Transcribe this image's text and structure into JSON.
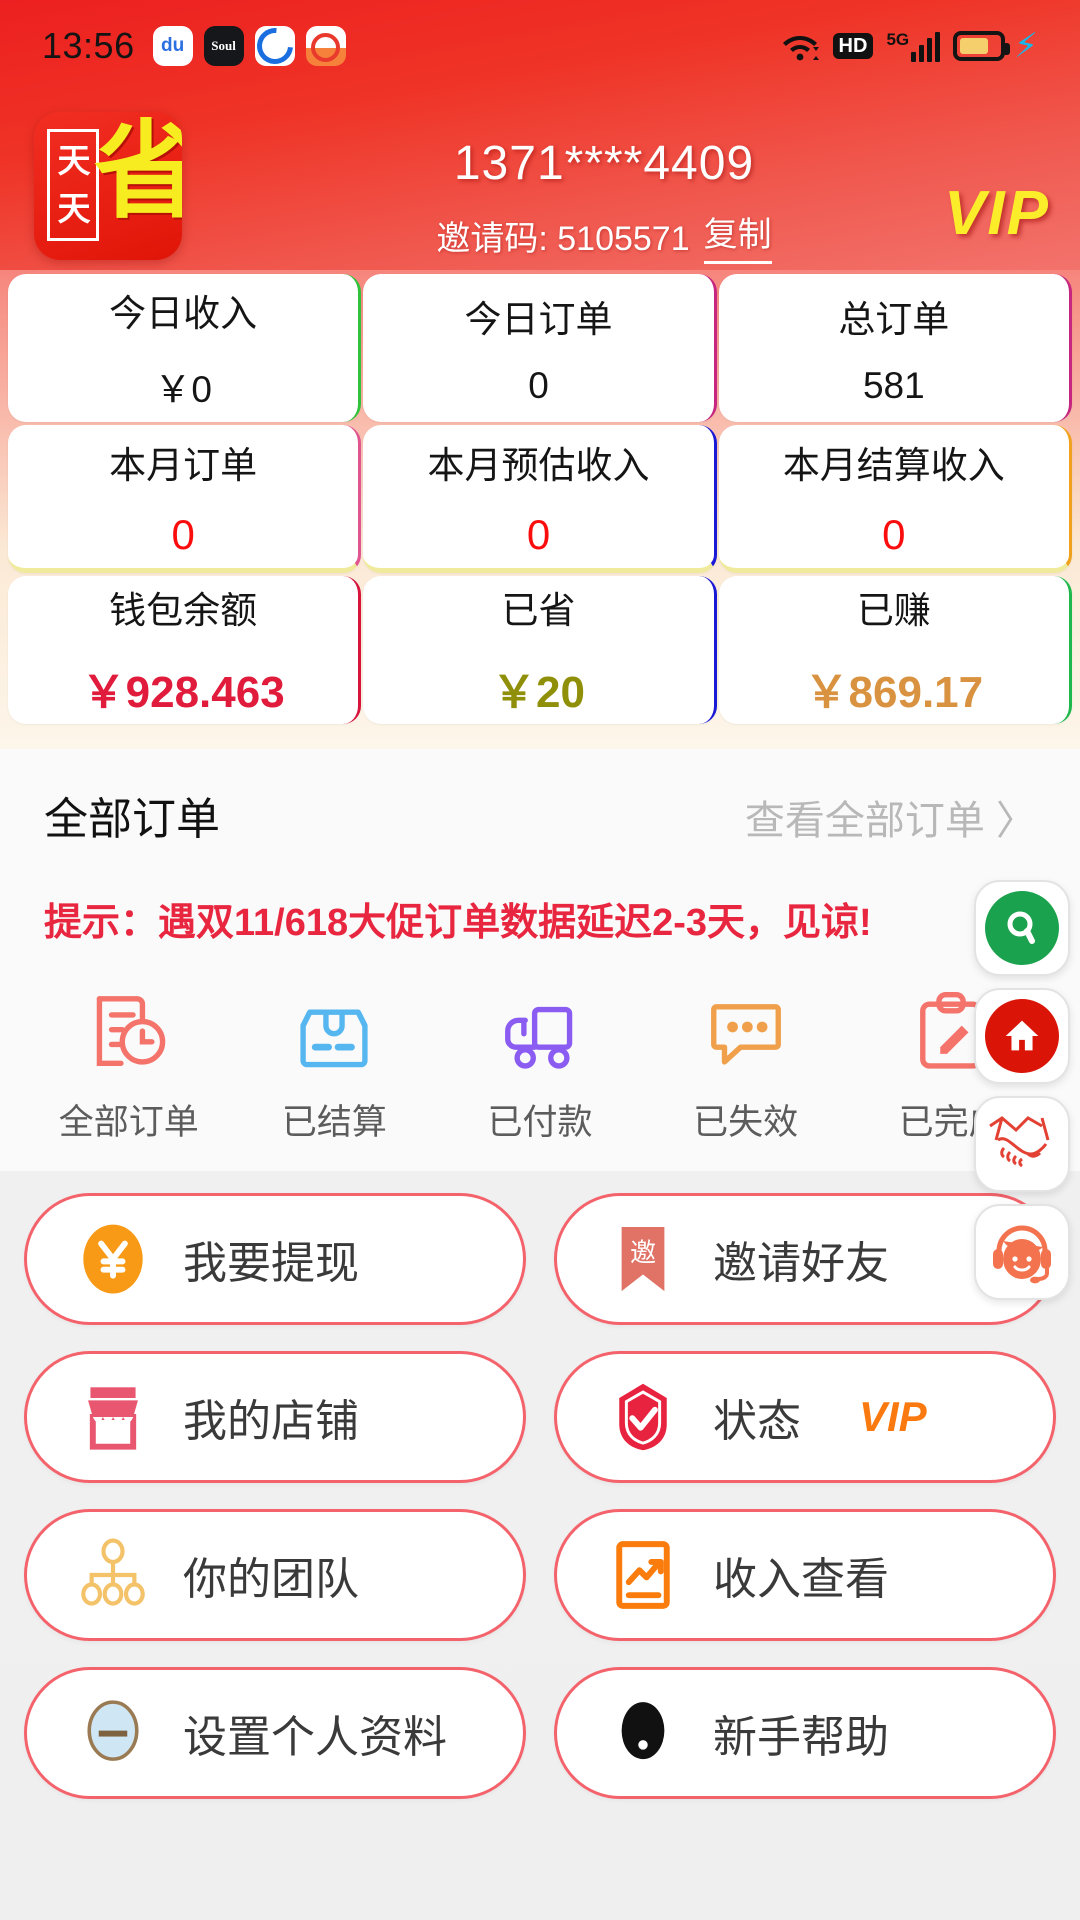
{
  "statusbar": {
    "time": "13:56",
    "apps": [
      "baidu-icon",
      "soul-icon",
      "qq-browser-icon",
      "calendar-icon"
    ],
    "app_labels": [
      "du",
      "Soul",
      "",
      ""
    ],
    "wifi": "wifi-icon",
    "hd": "HD",
    "network": "5G",
    "battery": "battery-icon",
    "charging": "charging-bolt-icon"
  },
  "header": {
    "logo_text_top": "天",
    "logo_text_bottom": "天",
    "logo_text_big": "省",
    "phone": "1371****4409",
    "invite_label": "邀请码: 5105571",
    "copy_label": "复制",
    "vip_badge": "VIP",
    "bg_color": "#ee3324"
  },
  "stats": {
    "rows": [
      [
        {
          "label": "今日收入",
          "value": "￥0",
          "accent": "#2fc23a"
        },
        {
          "label": "今日订单",
          "value": "0",
          "accent": "#c6267f"
        },
        {
          "label": "总订单",
          "value": "581",
          "accent": "#c6267f"
        }
      ],
      [
        {
          "label": "本月订单",
          "value": "0",
          "accent": "#e0548f"
        },
        {
          "label": "本月预估收入",
          "value": "0",
          "accent": "#1a1ad6"
        },
        {
          "label": "本月结算收入",
          "value": "0",
          "accent": "#f0a21e"
        }
      ],
      [
        {
          "label": "钱包余额",
          "value": "￥928.463",
          "accent": "#d6143c"
        },
        {
          "label": "已省",
          "value": "￥20",
          "accent": "#1a1ad6"
        },
        {
          "label": "已赚",
          "value": "￥869.17",
          "accent": "#1eb94d"
        }
      ]
    ]
  },
  "orders": {
    "title": "全部订单",
    "view_all": "查看全部订单 〉",
    "tip": "提示：遇双11/618大促订单数据延迟2-3天，见谅!",
    "tip_color": "#e8263f",
    "categories": [
      {
        "label": "全部订单",
        "icon": "order-doc-clock-icon",
        "color": "#f4736a"
      },
      {
        "label": "已结算",
        "icon": "package-box-icon",
        "color": "#56b6ef"
      },
      {
        "label": "已付款",
        "icon": "delivery-truck-icon",
        "color": "#8b5cf2"
      },
      {
        "label": "已失效",
        "icon": "speech-bubble-icon",
        "color": "#f0a04b"
      },
      {
        "label": "已完成",
        "icon": "clipboard-pencil-icon",
        "color": "#f4736a"
      }
    ]
  },
  "menu": {
    "rows": [
      [
        {
          "label": "我要提现",
          "icon": "yen-coin-icon",
          "sub": ""
        },
        {
          "label": "邀请好友",
          "icon": "invite-ribbon-icon",
          "sub": ""
        }
      ],
      [
        {
          "label": "我的店铺",
          "icon": "shop-icon",
          "sub": ""
        },
        {
          "label": "状态",
          "icon": "shield-check-icon",
          "sub": "VIP"
        }
      ],
      [
        {
          "label": "你的团队",
          "icon": "team-tree-icon",
          "sub": ""
        },
        {
          "label": "收入查看",
          "icon": "income-chart-icon",
          "sub": ""
        }
      ],
      [
        {
          "label": "设置个人资料",
          "icon": "avatar-profile-icon",
          "sub": ""
        },
        {
          "label": "新手帮助",
          "icon": "help-icon",
          "sub": ""
        }
      ]
    ],
    "border_color": "#f4636b"
  },
  "fabs": [
    {
      "icon": "search-icon",
      "style": "green"
    },
    {
      "icon": "home-icon",
      "style": "red"
    },
    {
      "icon": "handshake-icon",
      "style": "outline"
    },
    {
      "icon": "customer-service-icon",
      "style": "outline"
    }
  ]
}
